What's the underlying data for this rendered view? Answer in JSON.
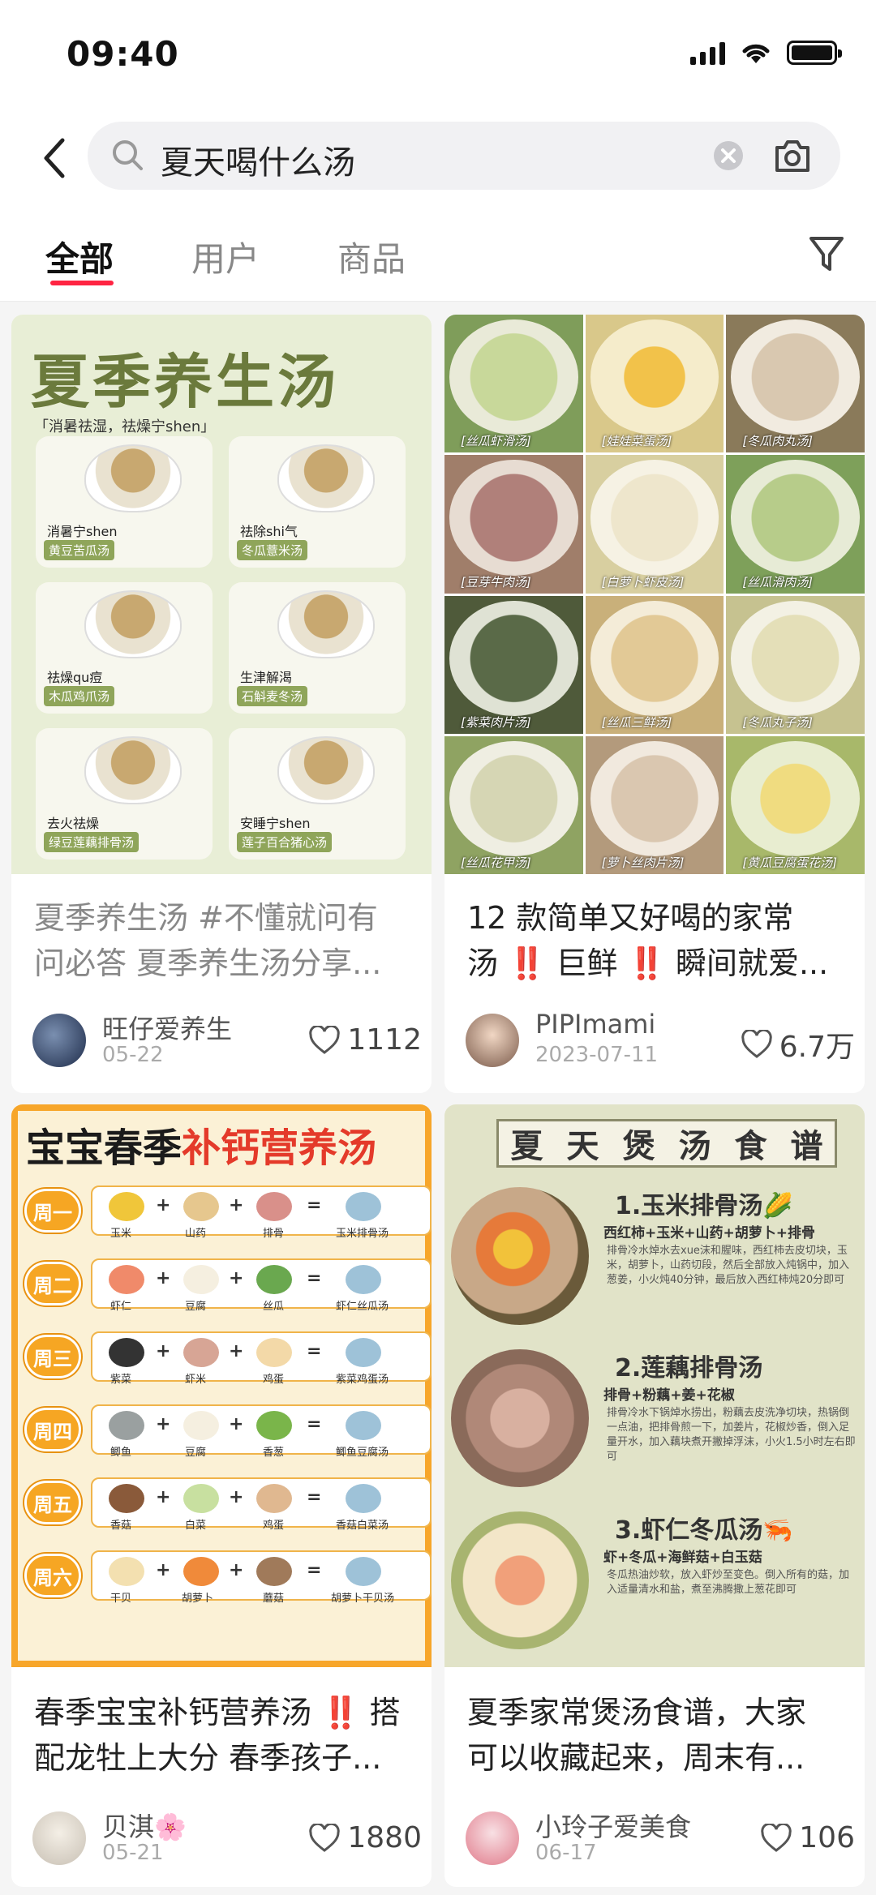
{
  "status_bar": {
    "time": "09:40"
  },
  "search": {
    "query": "夏天喝什么汤"
  },
  "tabs": [
    {
      "label": "全部"
    },
    {
      "label": "用户"
    },
    {
      "label": "商品"
    }
  ],
  "cards": [
    {
      "title_line1": "夏季养生汤 #不懂就问有",
      "title_line2": "问必答  夏季养生汤分享...",
      "author": "旺仔爱养生",
      "date": "05-22",
      "likes": "1112",
      "cover": {
        "title": "夏季养生汤",
        "subtitle": "「消暑祛湿，祛燥宁shen」",
        "tiles": [
          {
            "t1": "消暑宁shen",
            "t2": "黄豆苦瓜汤"
          },
          {
            "t1": "祛除shi气",
            "t2": "冬瓜薏米汤"
          },
          {
            "t1": "祛燥qu痘",
            "t2": "木瓜鸡爪汤"
          },
          {
            "t1": "生津解渴",
            "t2": "石斛麦冬汤"
          },
          {
            "t1": "去火祛燥",
            "t2": "绿豆莲藕排骨汤"
          },
          {
            "t1": "安睡宁shen",
            "t2": "莲子百合猪心汤"
          }
        ]
      }
    },
    {
      "title_line1": "12 款简单又好喝的家常",
      "title_line2": "汤 ‼️ 巨鲜 ‼️ 瞬间就爱...",
      "author": "PIPImami",
      "date": "2023-07-11",
      "likes": "6.7万",
      "cover": {
        "labels": [
          "[丝瓜虾滑汤]",
          "[娃娃菜蛋汤]",
          "[冬瓜肉丸汤]",
          "[豆芽牛肉汤]",
          "[白萝卜虾皮汤]",
          "[丝瓜滑肉汤]",
          "[紫菜肉片汤]",
          "[丝瓜三鲜汤]",
          "[冬瓜丸子汤]",
          "[丝瓜花甲汤]",
          "[萝卜丝肉片汤]",
          "[黄瓜豆腐蛋花汤]"
        ]
      }
    },
    {
      "title_line1": "春季宝宝补钙营养汤 ‼️ 搭",
      "title_line2": "配龙牡上大分 春季孩子...",
      "author": "贝淇🌸",
      "date": "05-21",
      "likes": "1880",
      "cover": {
        "title_a": "宝宝春季",
        "title_b": "补钙营养汤",
        "rows": [
          {
            "day": "周一",
            "items": [
              "玉米",
              "山药",
              "排骨",
              "玉米排骨汤"
            ]
          },
          {
            "day": "周二",
            "items": [
              "虾仁",
              "豆腐",
              "丝瓜",
              "虾仁丝瓜汤"
            ]
          },
          {
            "day": "周三",
            "items": [
              "紫菜",
              "虾米",
              "鸡蛋",
              "紫菜鸡蛋汤"
            ]
          },
          {
            "day": "周四",
            "items": [
              "鲫鱼",
              "豆腐",
              "香葱",
              "鲫鱼豆腐汤"
            ]
          },
          {
            "day": "周五",
            "items": [
              "香菇",
              "白菜",
              "鸡蛋",
              "香菇白菜汤"
            ]
          },
          {
            "day": "周六",
            "items": [
              "干贝",
              "胡萝卜",
              "蘑菇",
              "胡萝卜干贝汤"
            ]
          }
        ]
      }
    },
    {
      "title_line1": "夏季家常煲汤食谱，大家",
      "title_line2": "可以收藏起来，周末有...",
      "author": "小玲子爱美食",
      "date": "06-17",
      "likes": "106",
      "cover": {
        "heading": [
          "夏",
          "天",
          "煲",
          "汤",
          "食",
          "谱"
        ],
        "recipes": [
          {
            "name": "1.玉米排骨汤🌽",
            "ingredients": "西红柿+玉米+山药+胡萝卜+排骨",
            "steps": "排骨冷水焯水去xue沫和腥味，西红柿去皮切块，玉米，胡萝卜，山药切段，然后全部放入炖锅中，加入葱姜，小火炖40分钟，最后放入西红柿炖20分即可"
          },
          {
            "name": "2.莲藕排骨汤",
            "ingredients": "排骨+粉藕+姜+花椒",
            "steps": "排骨冷水下锅焯水捞出，粉藕去皮洗净切块，热锅倒一点油，把排骨煎一下，加姜片，花椒炒香，倒入足量开水，加入藕块煮开撇掉浮沫，小火1.5小时左右即可"
          },
          {
            "name": "3.虾仁冬瓜汤🦐",
            "ingredients": "虾+冬瓜+海鲜菇+白玉菇",
            "steps": "冬瓜热油炒软，放入虾炒至变色。倒入所有的菇，加入适量清水和盐，煮至沸腾撒上葱花即可"
          }
        ]
      }
    }
  ]
}
